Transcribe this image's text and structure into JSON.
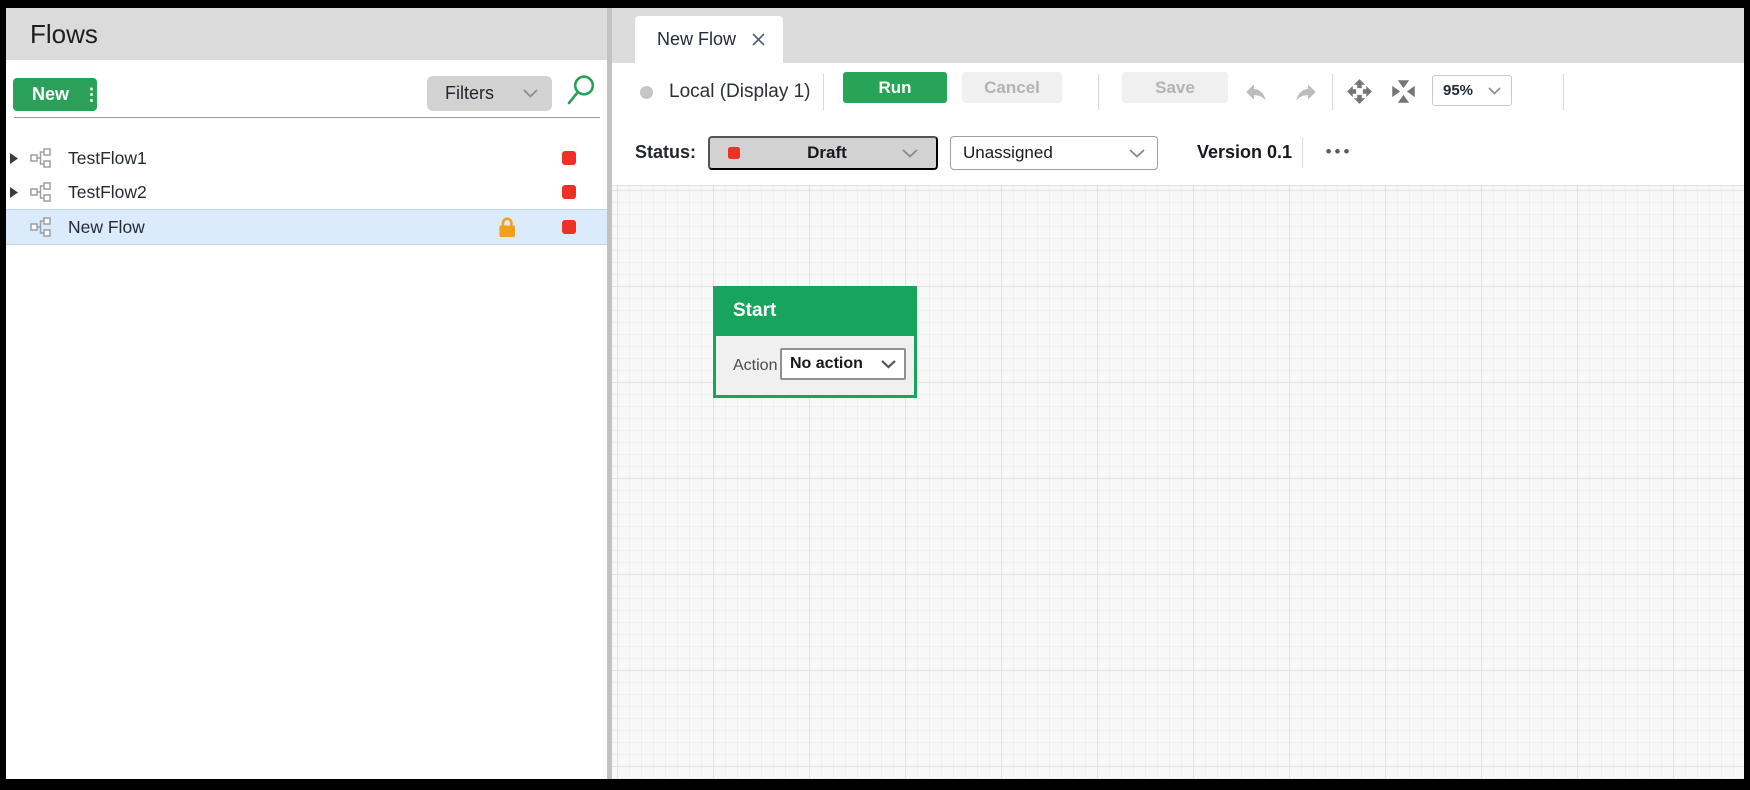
{
  "sidebar": {
    "header_title": "Flows",
    "new_button_label": "New",
    "new_button_menu_glyph": "⋮",
    "filters_label": "Filters",
    "flows": [
      {
        "name": "TestFlow1",
        "expandable": true,
        "locked": false,
        "selected": false,
        "status": "red"
      },
      {
        "name": "TestFlow2",
        "expandable": true,
        "locked": false,
        "selected": false,
        "status": "red"
      },
      {
        "name": "New Flow",
        "expandable": false,
        "locked": true,
        "selected": true,
        "status": "red"
      }
    ]
  },
  "editor": {
    "tab": {
      "label": "New Flow"
    },
    "toolbar": {
      "connection_label": "Local (Display 1)",
      "run_label": "Run",
      "cancel_label": "Cancel",
      "save_label": "Save",
      "zoom_value": "95%"
    },
    "status_bar": {
      "status_label": "Status:",
      "status_value": "Draft",
      "assignment_value": "Unassigned",
      "version_label": "Version 0.1",
      "more_glyph": "•••"
    },
    "canvas": {
      "start_node": {
        "title": "Start",
        "action_label": "Action",
        "action_value": "No action"
      }
    }
  },
  "colors": {
    "accent_green": "#2ba05a",
    "node_green": "#17a45c",
    "status_red": "#ee3124",
    "lock_orange": "#f0a11c",
    "selected_row_blue": "#dcebfb",
    "header_gray": "#dbdbdb"
  }
}
